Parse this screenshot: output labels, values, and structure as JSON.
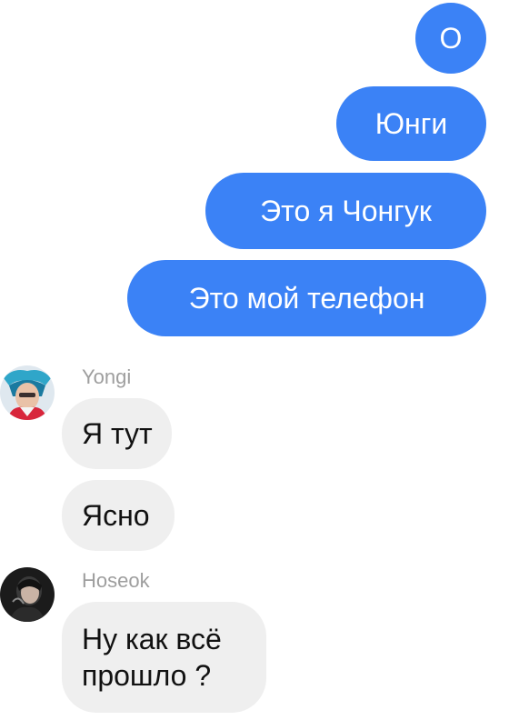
{
  "chat": {
    "outgoing": [
      {
        "text": "О"
      },
      {
        "text": "Юнги"
      },
      {
        "text": "Это я Чонгук"
      },
      {
        "text": "Это мой телефон"
      }
    ],
    "groups": [
      {
        "sender": "Yongi",
        "avatar_icon": "user-avatar-photo",
        "messages": [
          "Я тут",
          "Ясно"
        ]
      },
      {
        "sender": "Hoseok",
        "avatar_icon": "user-avatar-photo",
        "messages": [
          "Ну как всё\nпрошло ?"
        ]
      }
    ]
  },
  "colors": {
    "outgoing_bubble": "#3b82f6",
    "incoming_bubble": "#efefef",
    "sender_name": "#9e9e9e"
  }
}
